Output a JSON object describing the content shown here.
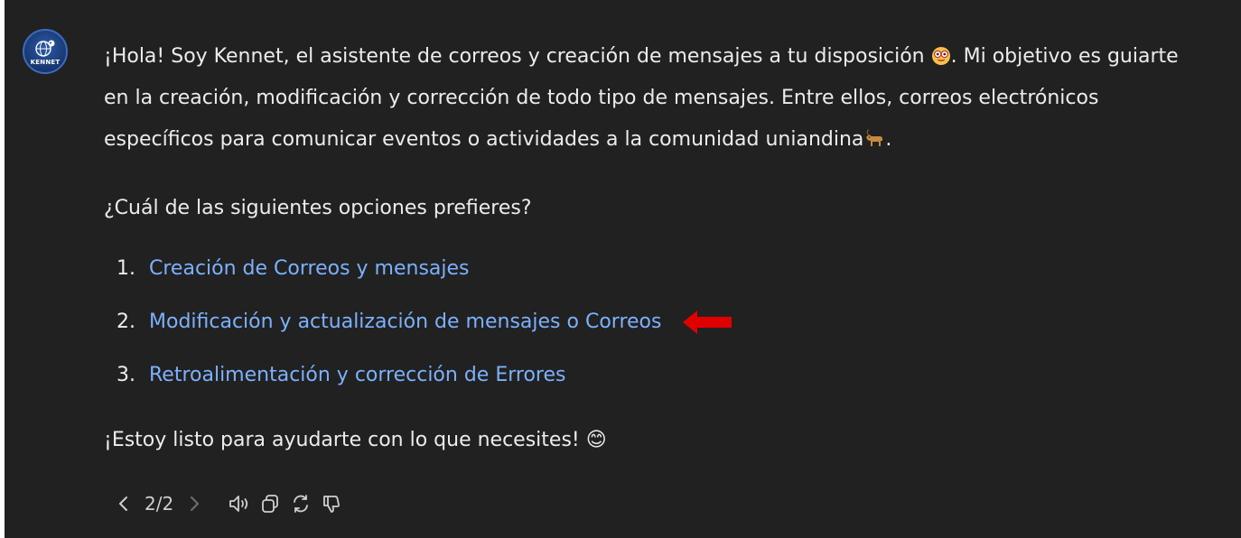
{
  "assistant": {
    "avatar_label": "KENNET"
  },
  "message": {
    "intro_part1": "¡Hola! Soy Kennet, el asistente de correos y creación de mensajes a tu disposición ",
    "intro_part2": ". Mi objetivo es guiarte en la creación, modificación y corrección de todo tipo de mensajes. Entre ellos, correos electrónicos específicos para comunicar eventos o actividades a la comunidad uniandina",
    "intro_part3": ".",
    "question": "¿Cuál de las siguientes opciones prefieres?",
    "options": [
      {
        "number": "1.",
        "label": "Creación de Correos y mensajes"
      },
      {
        "number": "2.",
        "label": "Modificación y actualización de mensajes o Correos"
      },
      {
        "number": "3.",
        "label": "Retroalimentación y corrección de Errores"
      }
    ],
    "closing": "¡Estoy listo para ayudarte con lo que necesites! ",
    "closing_emoji": "😊"
  },
  "toolbar": {
    "counter": "2/2"
  },
  "colors": {
    "background": "#212121",
    "text": "#ececec",
    "link": "#7cb1ff",
    "arrow": "#e10000"
  },
  "icons": [
    "previous-icon",
    "next-icon",
    "read-aloud-icon",
    "copy-icon",
    "regenerate-icon",
    "thumbs-down-icon"
  ]
}
